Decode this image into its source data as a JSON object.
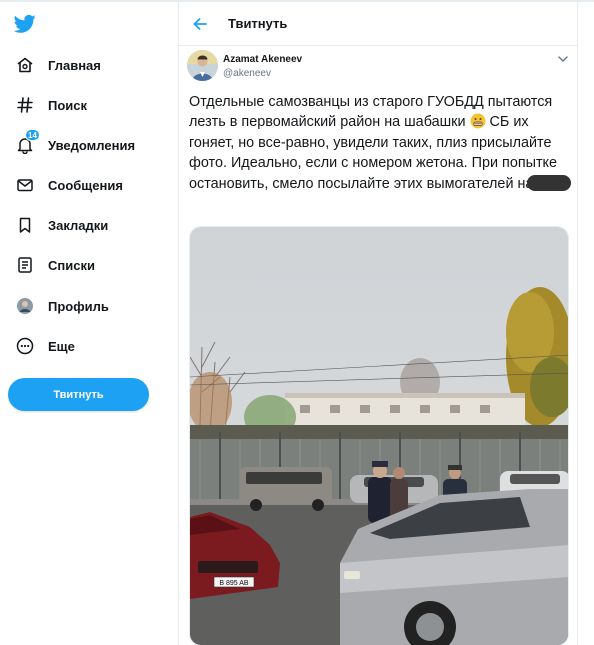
{
  "nav": {
    "items": [
      {
        "label": "Главная",
        "icon": "home-icon"
      },
      {
        "label": "Поиск",
        "icon": "hashtag-icon"
      },
      {
        "label": "Уведомления",
        "icon": "bell-icon",
        "badge": "14"
      },
      {
        "label": "Сообщения",
        "icon": "envelope-icon"
      },
      {
        "label": "Закладки",
        "icon": "bookmark-icon"
      },
      {
        "label": "Списки",
        "icon": "list-icon"
      },
      {
        "label": "Профиль",
        "icon": "avatar-icon"
      },
      {
        "label": "Еще",
        "icon": "more-circle-icon"
      }
    ],
    "tweet_button": "Твитнуть"
  },
  "header": {
    "title": "Твитнуть"
  },
  "tweet": {
    "author_name": "Azamat Akeneev",
    "author_handle": "@akeneev",
    "text_part1": "Отдельные самозванцы из старого ГУОБДД пытаются лезть в первомайский район на шабашки",
    "text_part2": "СБ их гоняет, но все-равно, увидели таких, плиз присылайте фото. Идеально, если с номером жетона. При попытке остановить, смело посылайте этих вымогателей на",
    "photo_plate_text": "B 895 AB"
  },
  "colors": {
    "accent": "#1da1f2",
    "text": "#14171a",
    "muted": "#657786",
    "border": "#e6ecf0"
  }
}
